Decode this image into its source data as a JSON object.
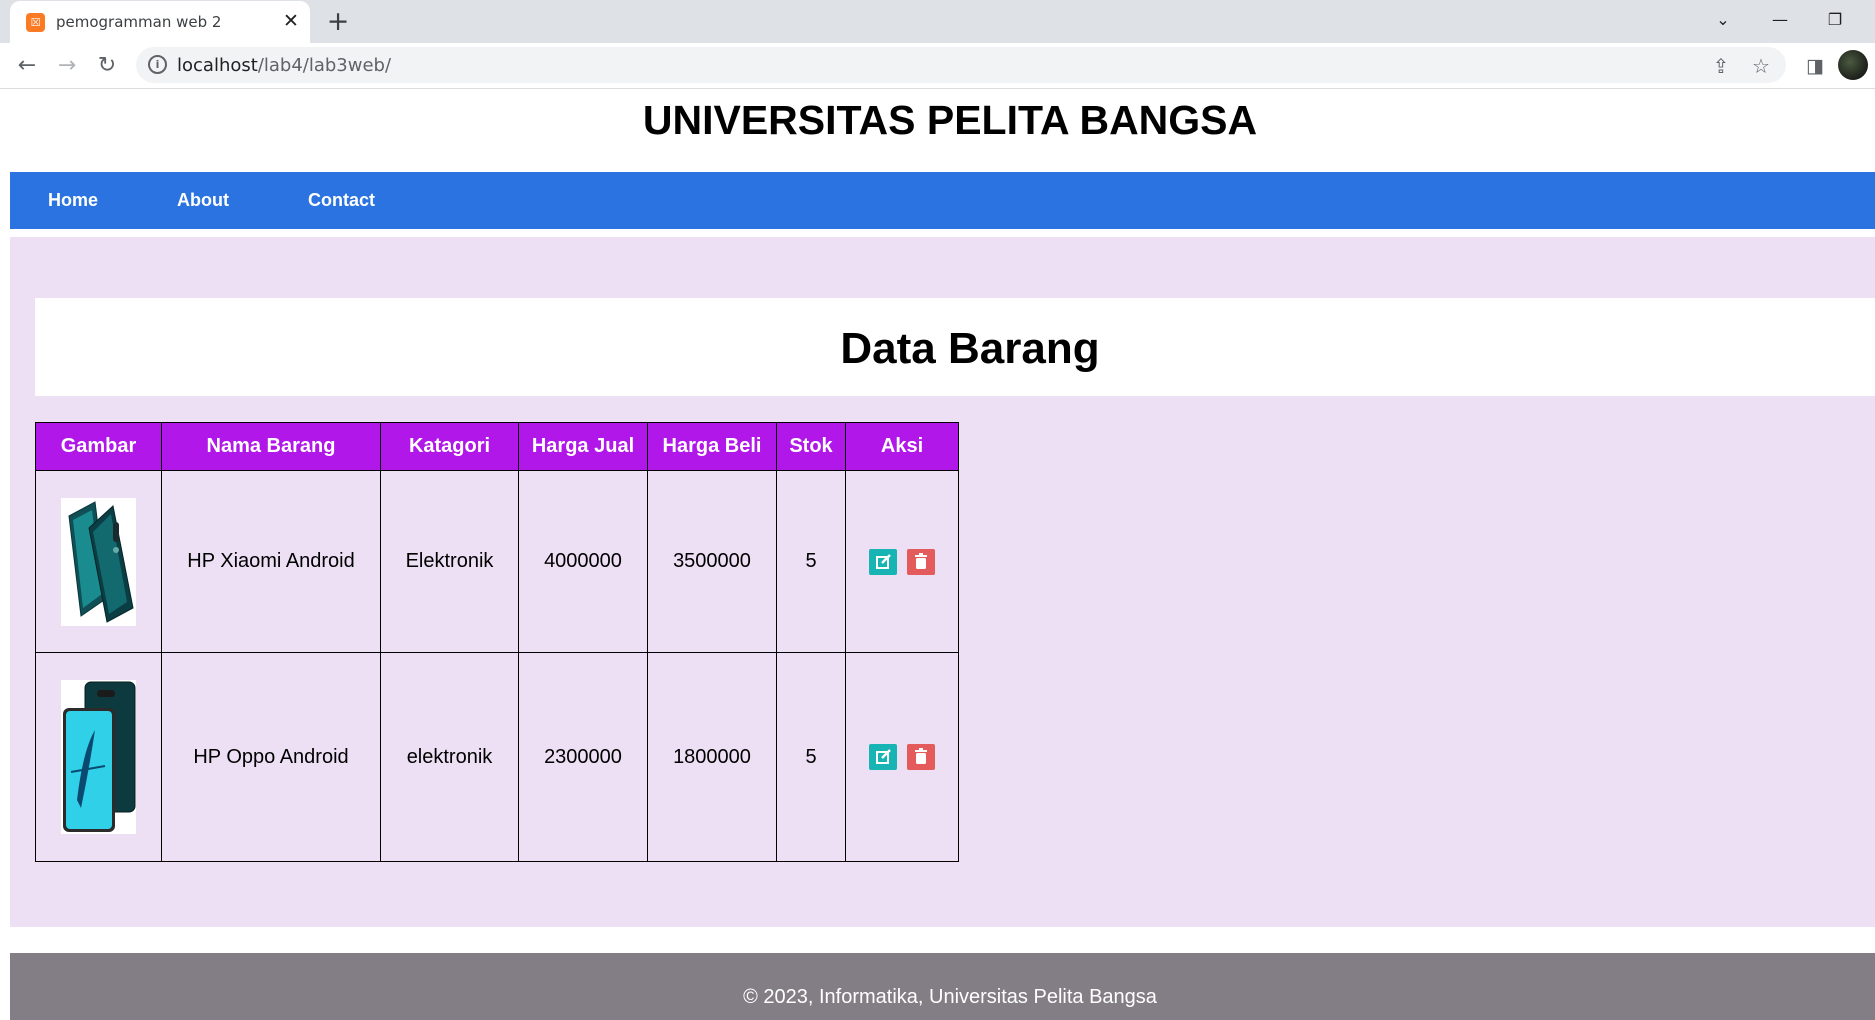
{
  "browser": {
    "tab_title": "pemogramman web 2",
    "tab_favicon_label": "☒",
    "url_host": "localhost",
    "url_path": "/lab4/lab3web/"
  },
  "site": {
    "title": "UNIVERSITAS PELITA BANGSA",
    "nav": [
      "Home",
      "About",
      "Contact"
    ]
  },
  "main": {
    "heading": "Data Barang",
    "columns": [
      "Gambar",
      "Nama Barang",
      "Katagori",
      "Harga Jual",
      "Harga Beli",
      "Stok",
      "Aksi"
    ],
    "rows": [
      {
        "nama": "HP Xiaomi Android",
        "kategori": "Elektronik",
        "harga_jual": "4000000",
        "harga_beli": "3500000",
        "stok": "5",
        "image": "xiaomi-phone"
      },
      {
        "nama": "HP Oppo Android",
        "kategori": "elektronik",
        "harga_jual": "2300000",
        "harga_beli": "1800000",
        "stok": "5",
        "image": "oppo-phone"
      }
    ]
  },
  "footer": {
    "text": "© 2023, Informatika, Universitas Pelita Bangsa"
  },
  "colors": {
    "nav_bg": "#2a73e0",
    "table_header_bg": "#b117e8",
    "content_bg": "#ede0f5",
    "edit_button": "#18b4b4",
    "delete_button": "#e35b5b",
    "footer_bg": "#837d85"
  }
}
